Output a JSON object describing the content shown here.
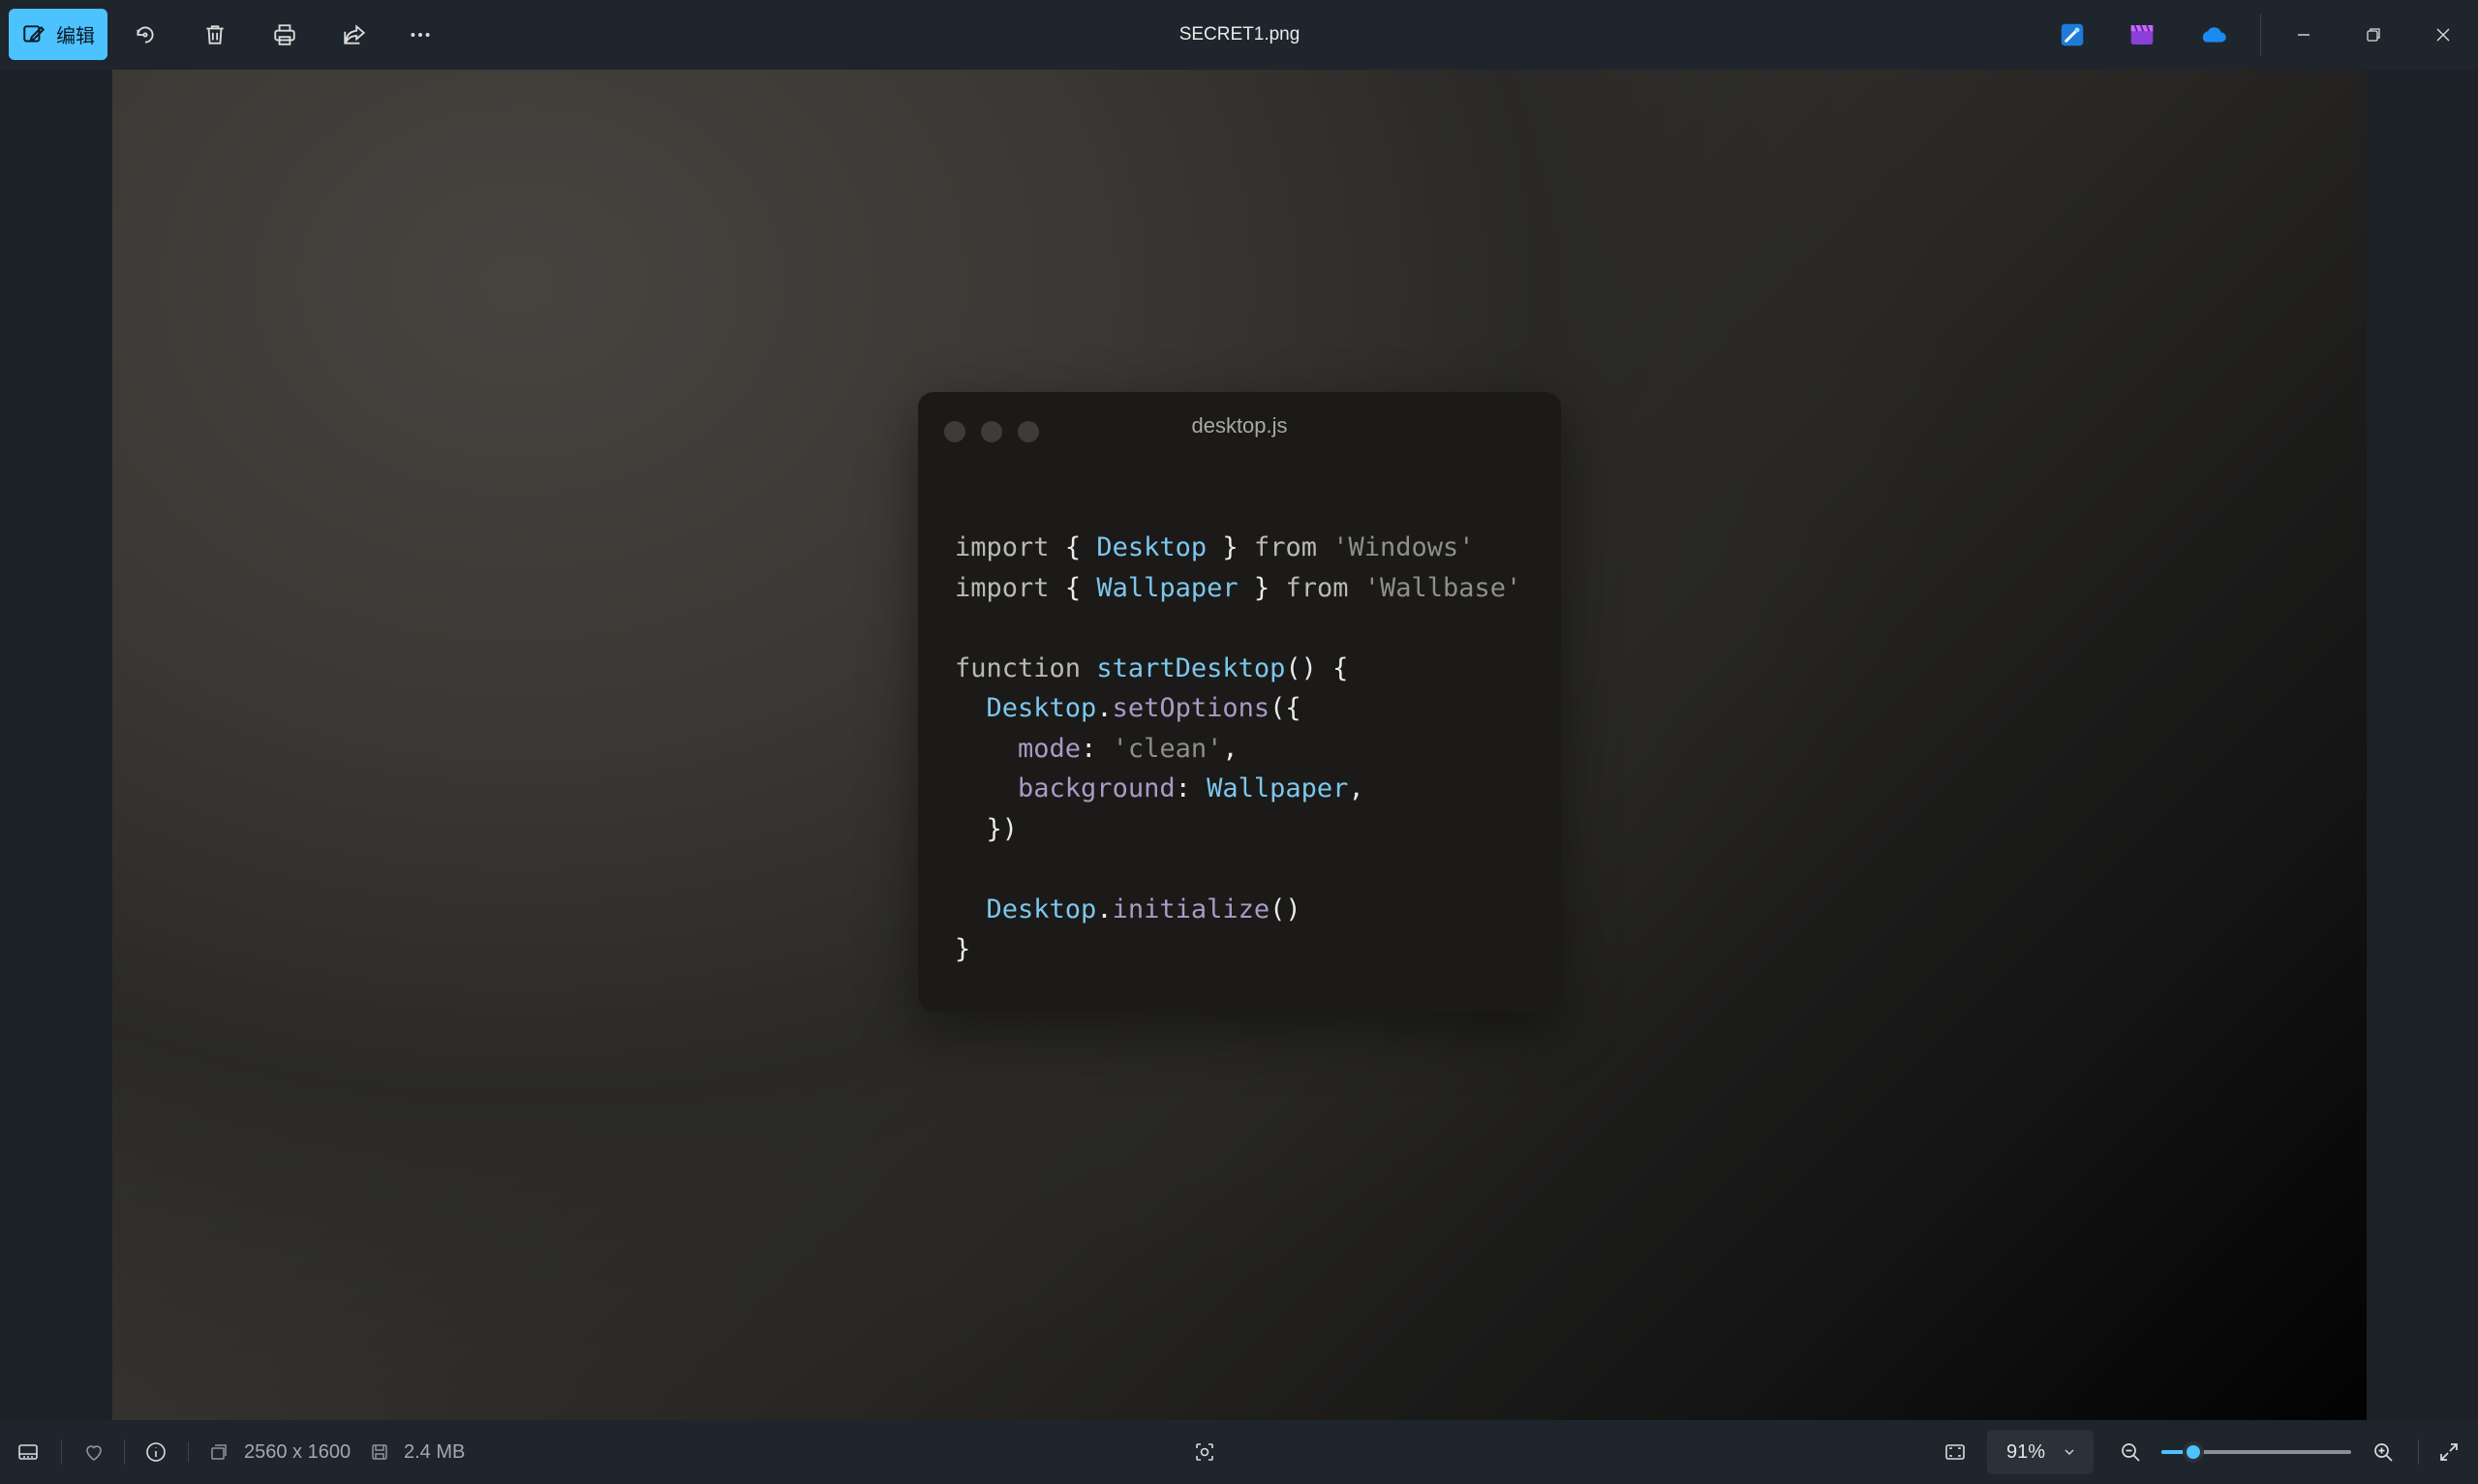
{
  "toolbar": {
    "edit_label": "编辑",
    "window_title": "SECRET1.png",
    "icons": [
      "edit-icon",
      "rotate-icon",
      "delete-icon",
      "print-icon",
      "share-icon",
      "more-icon",
      "designer-icon",
      "clipchamp-icon",
      "onedrive-icon",
      "minimize-icon",
      "restore-icon",
      "close-icon"
    ]
  },
  "image": {
    "code_window": {
      "filename": "desktop.js"
    }
  },
  "status": {
    "dimensions": "2560 x 1600",
    "file_size": "2.4 MB",
    "zoom": "91%",
    "zoom_fraction": 0.17
  },
  "colors": {
    "accent": "#4cc2ff",
    "toolbar_bg": "#1f252c"
  }
}
